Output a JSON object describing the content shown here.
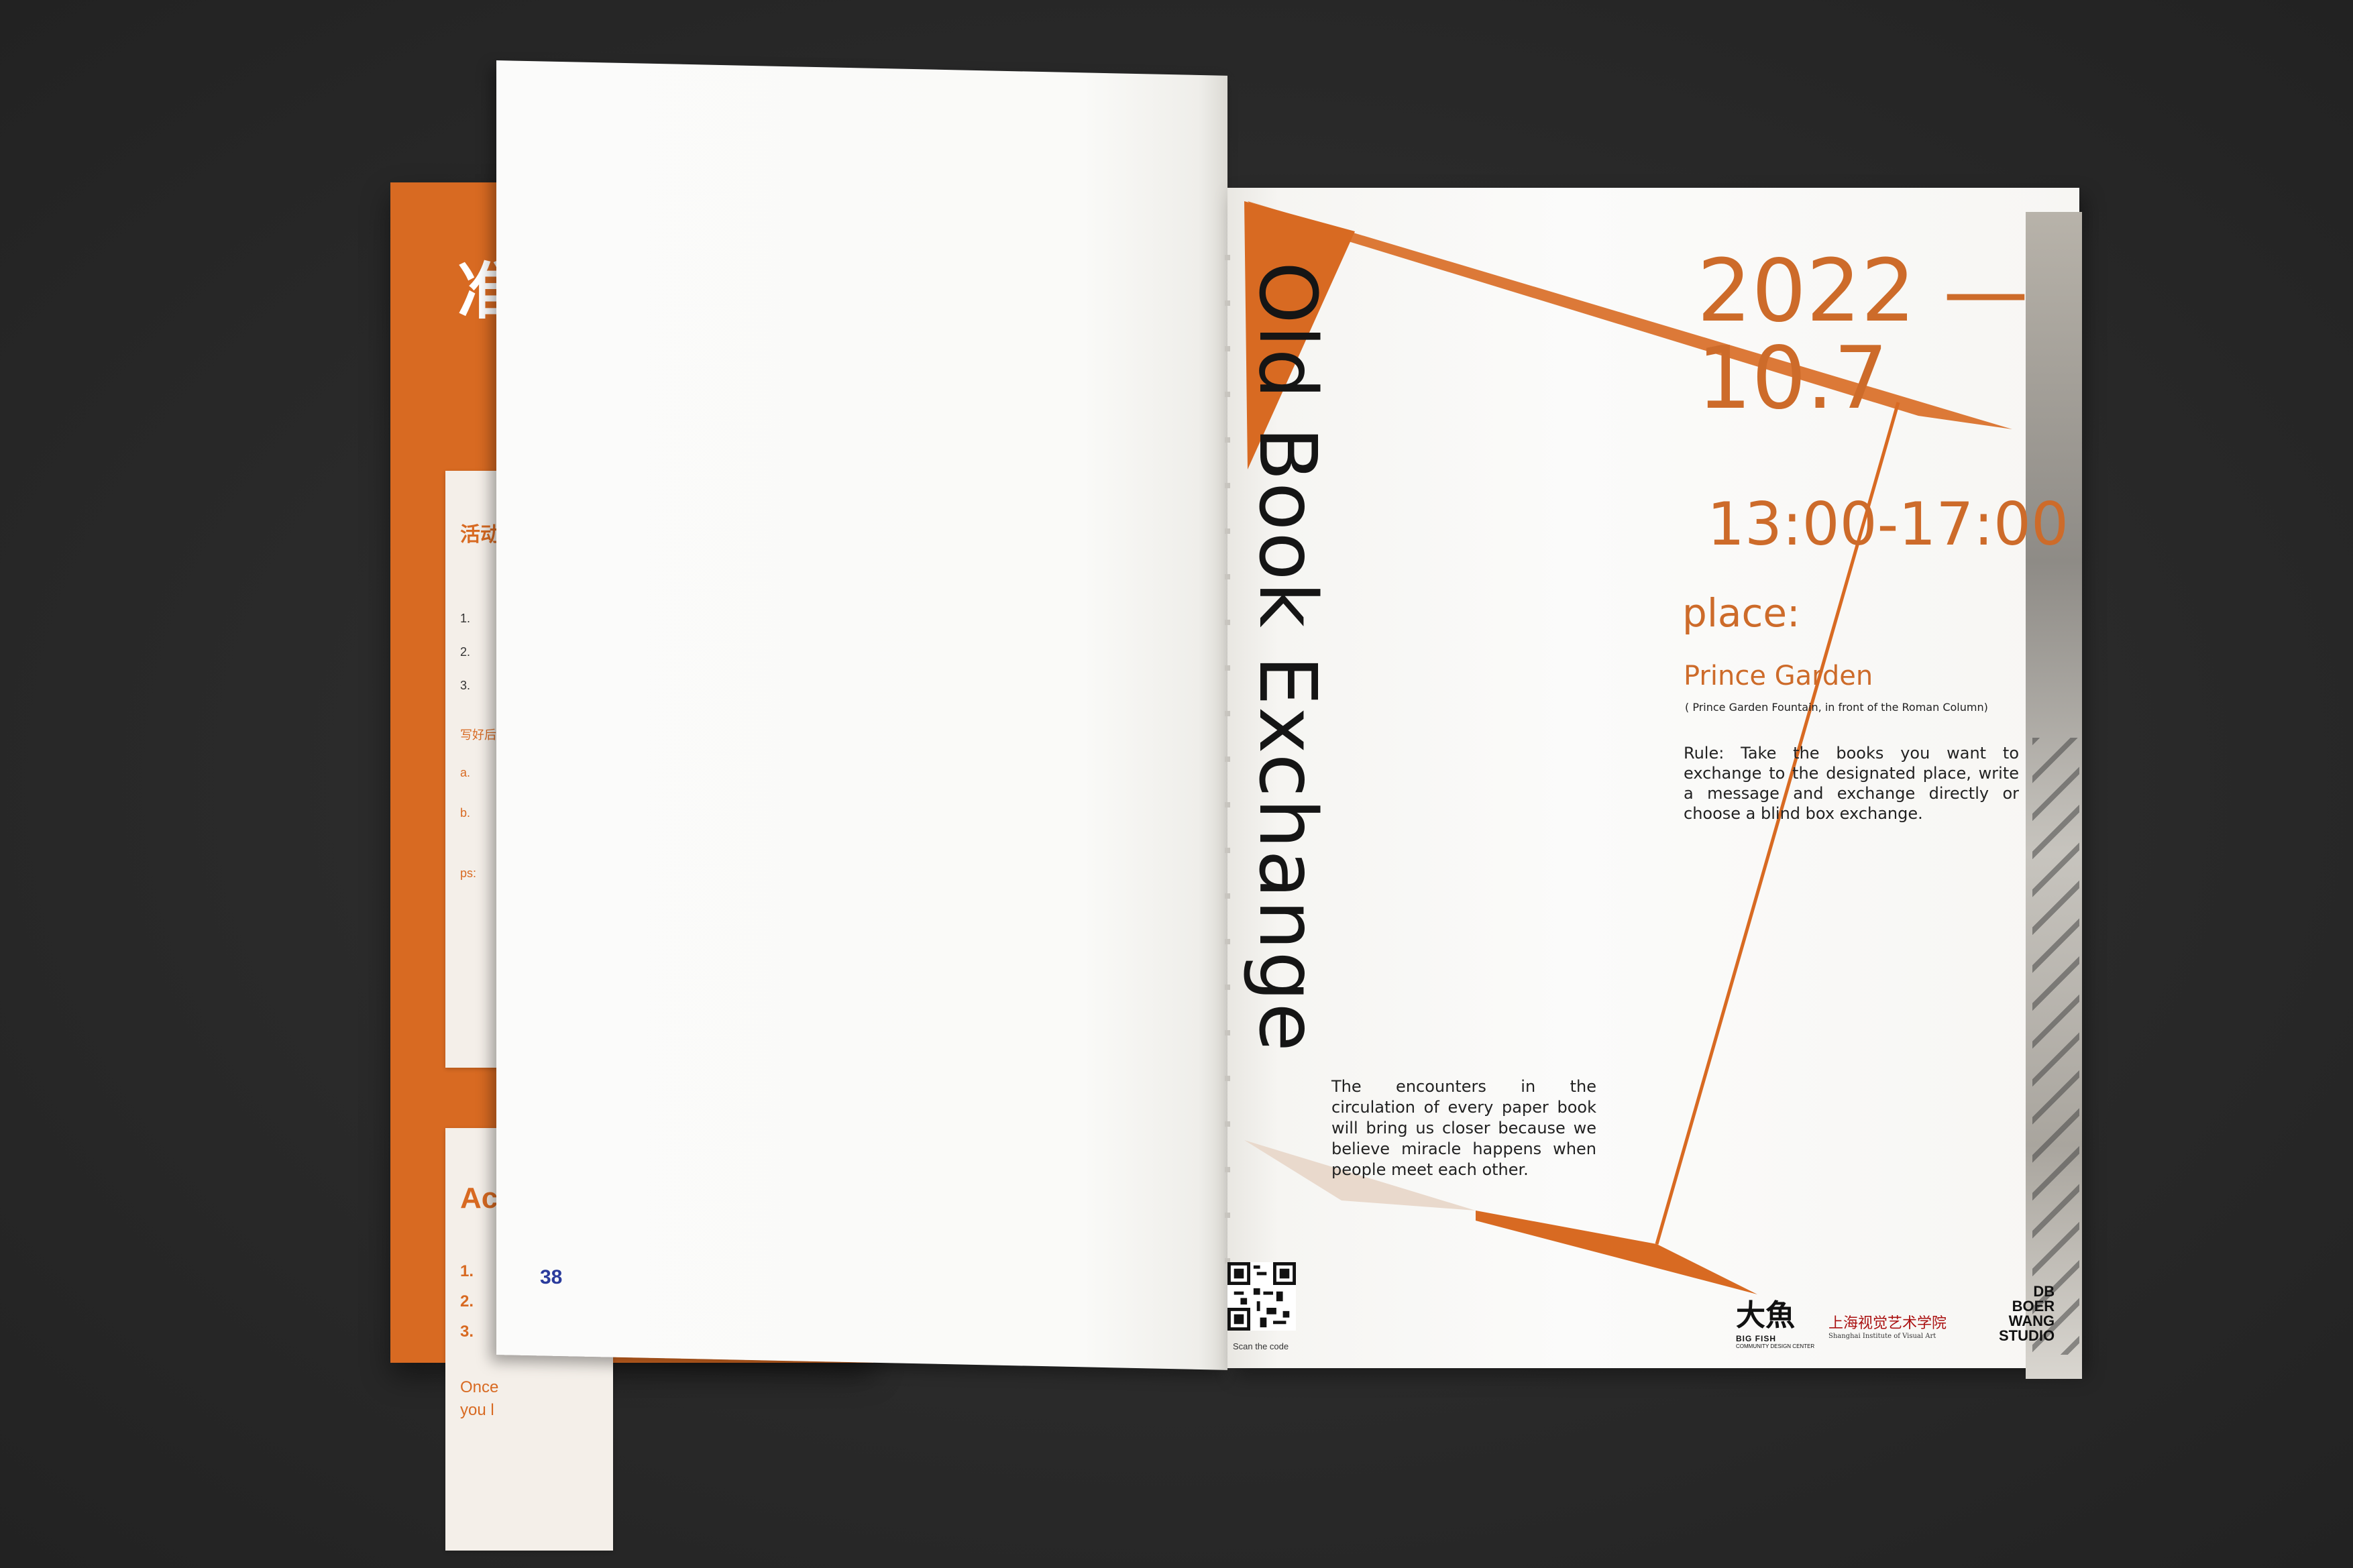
{
  "back_book": {
    "title_zh": "准",
    "card1_head": "活动",
    "card1_rows": [
      "1.",
      "2.",
      "3.",
      "写好后,",
      "a.",
      "b.",
      "ps:"
    ],
    "card2_head": "Ac",
    "card2_rows": [
      "1.",
      "2.",
      "3."
    ],
    "card2_tail": "Once\nyou l"
  },
  "left_page": {
    "page_number": "38"
  },
  "right_page": {
    "title": "Old Book Exchange",
    "date_line1": "2022 —",
    "date_line2": "10.7",
    "time": "13:00-17:00",
    "place_label": "place:",
    "place_name": "Prince Garden",
    "place_detail": "( Prince Garden Fountain, in front of the Roman Column)",
    "rule": "Rule: Take the books you want to exchange to the designated place, write a message and exchange directly or choose a blind box exchange.",
    "blurb": "The encounters in the circulation of every paper book will bring us closer because we believe miracle happens when people meet each other.",
    "scan_label": "Scan the code",
    "logos": {
      "bigfish_big": "大魚",
      "bigfish_small": "BIG FISH",
      "bigfish_sub": "COMMUNITY DESIGN CENTER",
      "shanghai": "上海视觉艺术学院",
      "shanghai_sub": "Shanghai Institute of Visual Art",
      "db_line1": "DB",
      "db_line2": "BOER",
      "db_line3": "WANG",
      "db_line4": "STUDIO"
    }
  },
  "colors": {
    "accent_orange": "#d86a22",
    "page_number_blue": "#2a3b9c",
    "background": "#2b2b2b"
  }
}
